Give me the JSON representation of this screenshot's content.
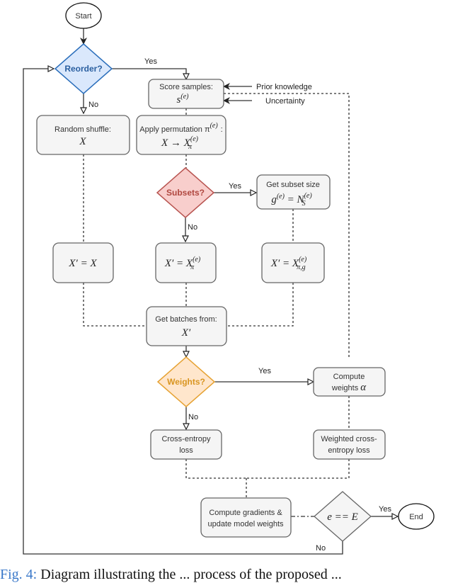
{
  "nodes": {
    "start": "Start",
    "reorder": "Reorder?",
    "score_samples": {
      "line1": "Score samples:",
      "math": "s",
      "sup": "(e)"
    },
    "random_shuffle": {
      "line1": "Random shuffle:",
      "math": "X"
    },
    "apply_permutation": {
      "line1": "Apply permutation π",
      "sup": "(e)",
      "tail": ":",
      "math_lhs": "X → X",
      "math_sub": "π",
      "math_sup": "(e)"
    },
    "subsets": "Subsets?",
    "subset_size": {
      "line1": "Get subset size",
      "math_lhs": "g",
      "lhs_sup": "(e)",
      "eq": " = N",
      "sub": "S",
      "sup": "(e)"
    },
    "x_eq_x": "X′ = X",
    "x_eq_xpi": {
      "lhs": "X′ = X",
      "sub": "π",
      "sup": "(e)"
    },
    "x_eq_xpig": {
      "lhs": "X′ = X",
      "sub": "π,g",
      "sup": "(e)"
    },
    "get_batches": {
      "line1": "Get batches from:",
      "math": "X′"
    },
    "weights": "Weights?",
    "compute_weights": {
      "line1": "Compute",
      "line2": "weights",
      "math": "α"
    },
    "cross_entropy": {
      "line1": "Cross-entropy",
      "line2": "loss"
    },
    "weighted_ce": {
      "line1": "Weighted cross-",
      "line2": "entropy loss"
    },
    "compute_gradients": {
      "line1": "Compute gradients &",
      "line2": "update model weights"
    },
    "epoch_check": "e == E",
    "end": "End"
  },
  "edge_labels": {
    "reorder_yes": "Yes",
    "reorder_no": "No",
    "subsets_yes": "Yes",
    "subsets_no": "No",
    "weights_yes": "Yes",
    "weights_no": "No",
    "epoch_yes": "Yes",
    "epoch_no": "No"
  },
  "inputs": {
    "prior_knowledge": "Prior knowledge",
    "uncertainty": "Uncertainty"
  },
  "colors": {
    "reorder_fill": "#dae8fc",
    "reorder_stroke": "#2a6ebb",
    "reorder_text": "#2a5fa0",
    "subsets_fill": "#f8cecc",
    "subsets_stroke": "#b85450",
    "subsets_text": "#b0473f",
    "weights_fill": "#ffe6cc",
    "weights_stroke": "#e6a233",
    "weights_text": "#d99520",
    "box_fill": "#f5f5f5",
    "box_stroke": "#666666"
  },
  "caption": {
    "figref": "Fig. 4:",
    "text": " Diagram illustrating the ... process of the proposed ..."
  }
}
